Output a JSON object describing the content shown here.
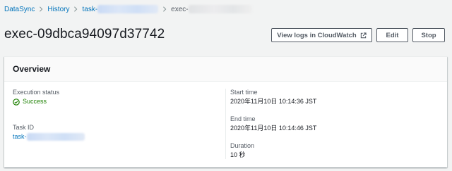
{
  "breadcrumb": {
    "items": [
      {
        "label": "DataSync"
      },
      {
        "label": "History"
      },
      {
        "label": "task-"
      },
      {
        "label": "exec-"
      }
    ]
  },
  "header": {
    "title": "exec-09dbca94097d37742"
  },
  "actions": {
    "view_logs_label": "View logs in CloudWatch",
    "edit_label": "Edit",
    "stop_label": "Stop"
  },
  "overview": {
    "title": "Overview",
    "execution_status": {
      "label": "Execution status",
      "value": "Success"
    },
    "task_id": {
      "label": "Task ID",
      "value": "task-"
    },
    "start_time": {
      "label": "Start time",
      "value": "2020年11月10日 10:14:36 JST"
    },
    "end_time": {
      "label": "End time",
      "value": "2020年11月10日 10:14:46 JST"
    },
    "duration": {
      "label": "Duration",
      "value": "10 秒"
    }
  },
  "colors": {
    "link": "#0073bb",
    "success": "#1d8102",
    "background": "#f2f3f3",
    "text": "#16191f",
    "button_border": "#545b64"
  },
  "icons": {
    "external_link": "external-link-icon",
    "success": "check-circle-icon",
    "separator": "chevron-right-icon"
  }
}
